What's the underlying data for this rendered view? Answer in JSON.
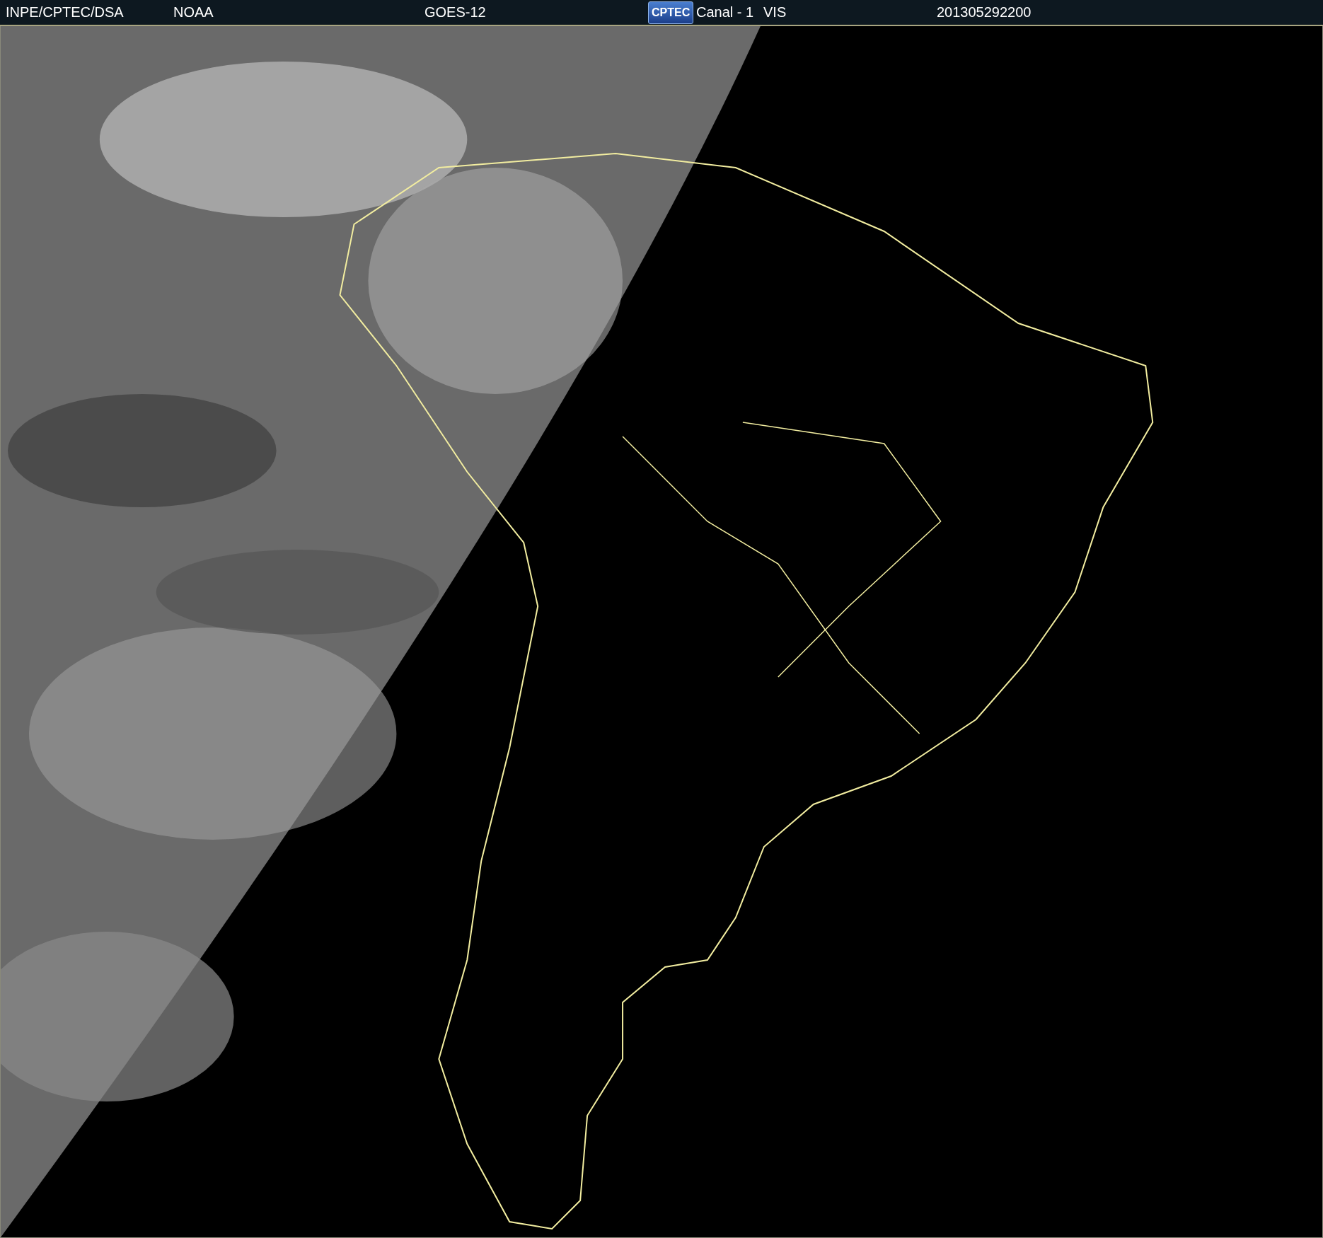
{
  "header": {
    "items": [
      {
        "kind": "text",
        "text": "INPE/CPTEC/DSA"
      },
      {
        "kind": "text",
        "text": "NOAA"
      },
      {
        "kind": "text",
        "text": "GOES-12"
      },
      {
        "kind": "logo",
        "text": "CPTEC"
      },
      {
        "kind": "text",
        "text": "Canal - 1"
      },
      {
        "kind": "text",
        "text": "VIS"
      },
      {
        "kind": "text",
        "text": "201305292200"
      }
    ]
  }
}
